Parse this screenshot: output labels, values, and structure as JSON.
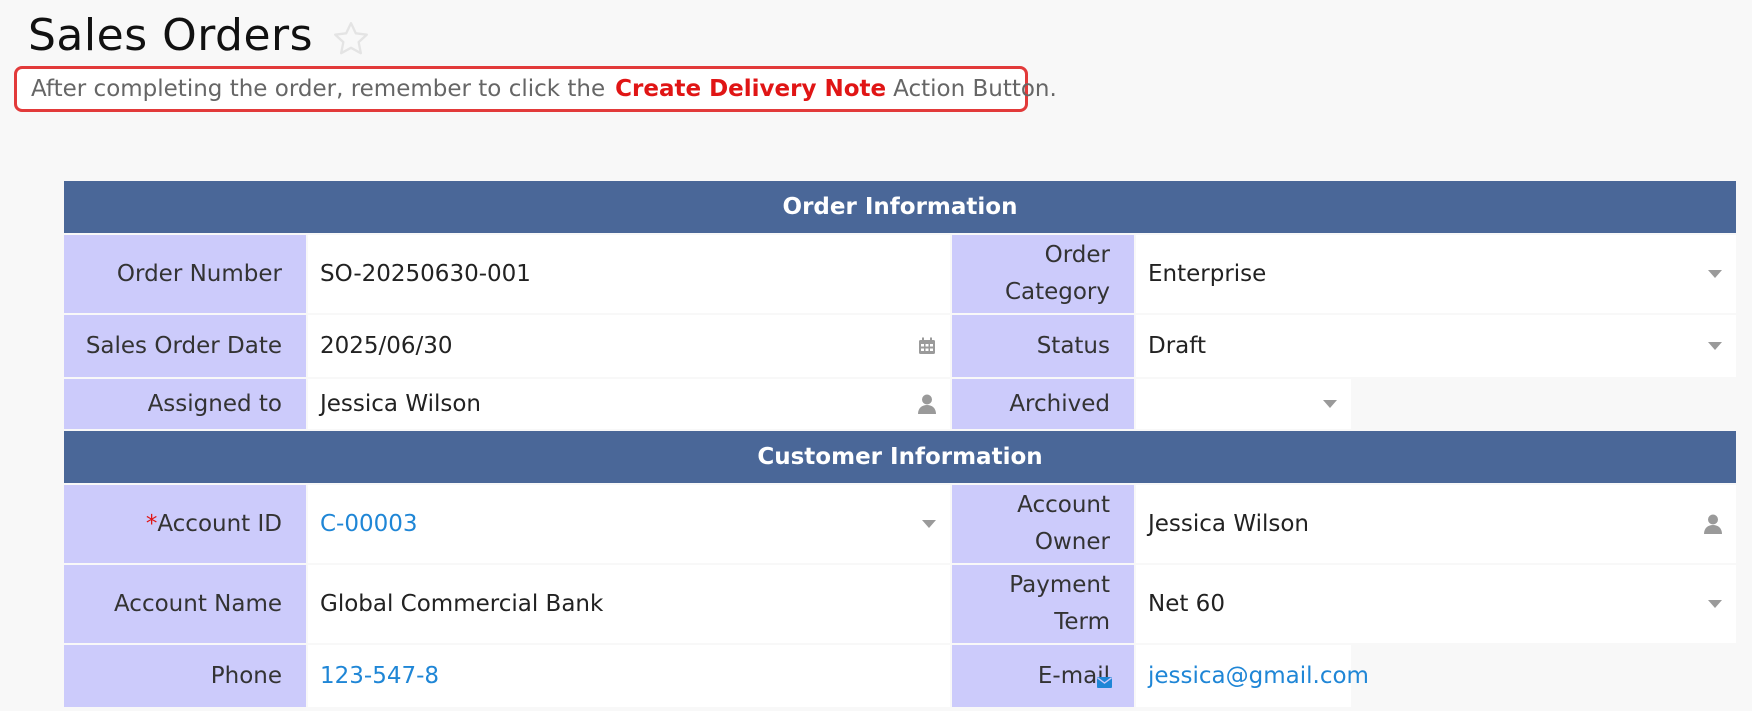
{
  "page": {
    "title": "Sales Orders",
    "notice": {
      "prefix": "After completing the order, remember to click the",
      "highlight": "Create Delivery Note",
      "suffix": "Action Button."
    }
  },
  "sections": {
    "order": {
      "header": "Order Information",
      "order_number": {
        "label": "Order Number",
        "value": "SO-20250630-001"
      },
      "order_category": {
        "label": "Order Category",
        "value": "Enterprise"
      },
      "sales_order_date": {
        "label": "Sales Order Date",
        "value": "2025/06/30"
      },
      "status": {
        "label": "Status",
        "value": "Draft"
      },
      "assigned_to": {
        "label": "Assigned to",
        "value": "Jessica Wilson"
      },
      "archived": {
        "label": "Archived",
        "value": ""
      }
    },
    "customer": {
      "header": "Customer Information",
      "account_id": {
        "required_mark": "*",
        "label": "Account ID",
        "value": "C-00003"
      },
      "account_owner": {
        "label": "Account Owner",
        "value": "Jessica Wilson"
      },
      "account_name": {
        "label": "Account Name",
        "value": "Global Commercial Bank"
      },
      "payment_term": {
        "label": "Payment Term",
        "value": "Net 60"
      },
      "phone": {
        "label": "Phone",
        "value": "123-547-8"
      },
      "email": {
        "label": "E-mail",
        "value": "jessica@gmail.com"
      }
    }
  },
  "icons": {
    "favorite": "star-icon",
    "calendar": "calendar-icon",
    "user": "user-icon",
    "dropdown": "chevron-down-icon",
    "email": "envelope-icon"
  },
  "colors": {
    "section_header": "#4a6798",
    "label_bg": "#cccbfb",
    "notice_border": "#e23a3a",
    "highlight": "#e01515",
    "link": "#1f86d6"
  }
}
